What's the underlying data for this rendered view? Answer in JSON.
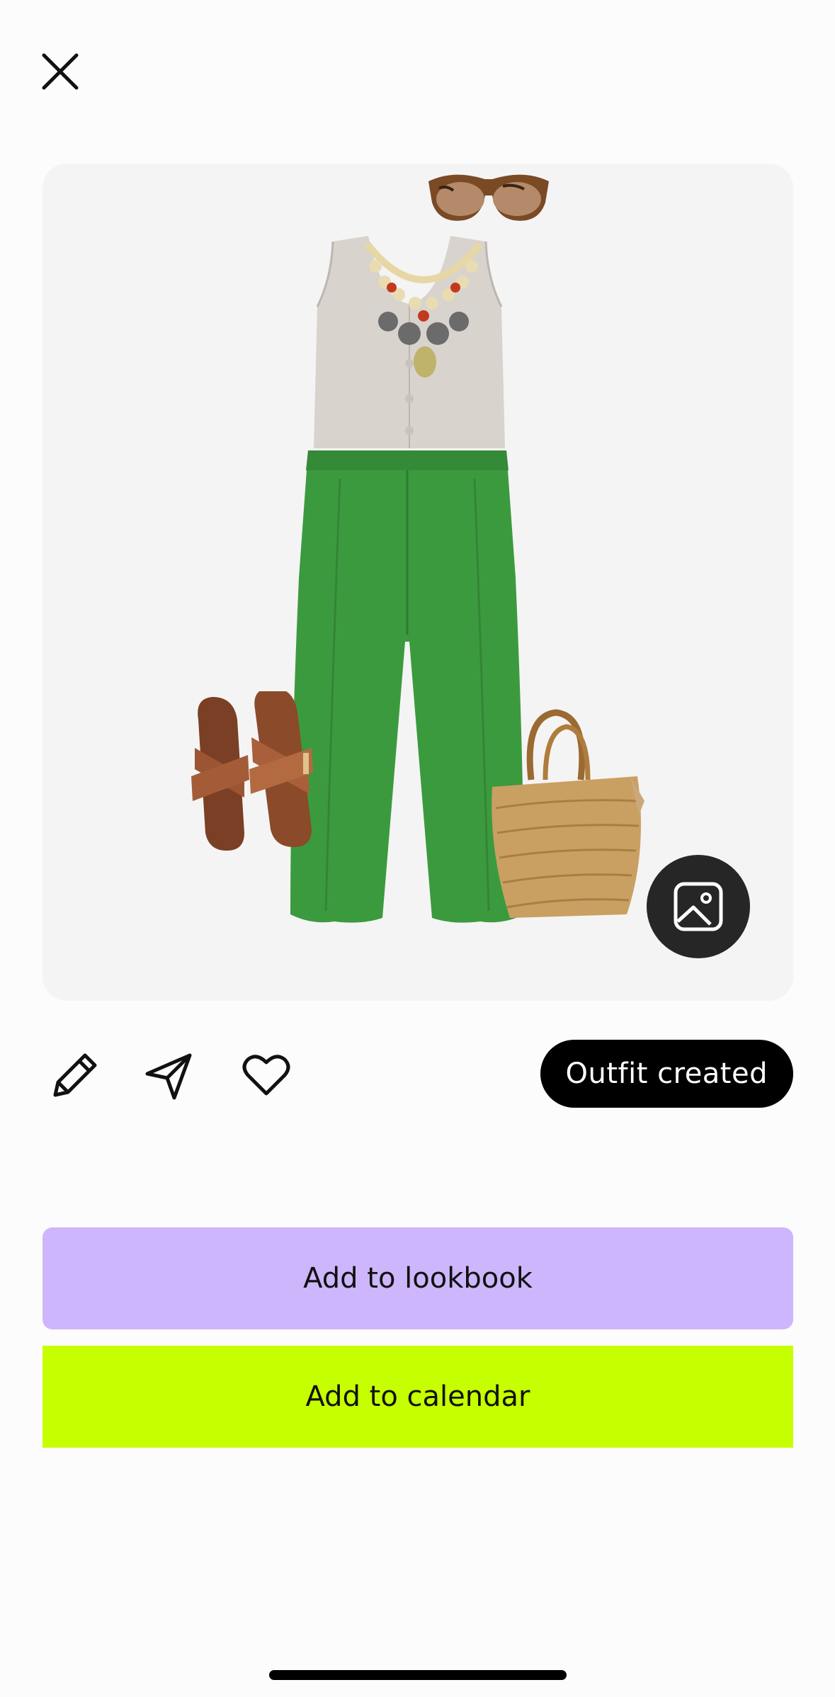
{
  "header": {
    "close_icon": "close-icon"
  },
  "outfit": {
    "items": [
      "sunglasses",
      "tank-top",
      "necklace",
      "wide-leg-pants",
      "sandals",
      "straw-tote-bag"
    ],
    "photo_button_icon": "image-icon"
  },
  "actions": {
    "edit_icon": "pencil-icon",
    "share_icon": "paper-plane-icon",
    "favorite_icon": "heart-icon",
    "status_label": "Outfit created"
  },
  "buttons": {
    "lookbook_label": "Add to lookbook",
    "calendar_label": "Add to calendar"
  },
  "colors": {
    "lookbook_bg": "#cdb6fb",
    "calendar_bg": "#c6ff00",
    "status_bg": "#000000",
    "canvas_bg": "#f4f4f4"
  }
}
